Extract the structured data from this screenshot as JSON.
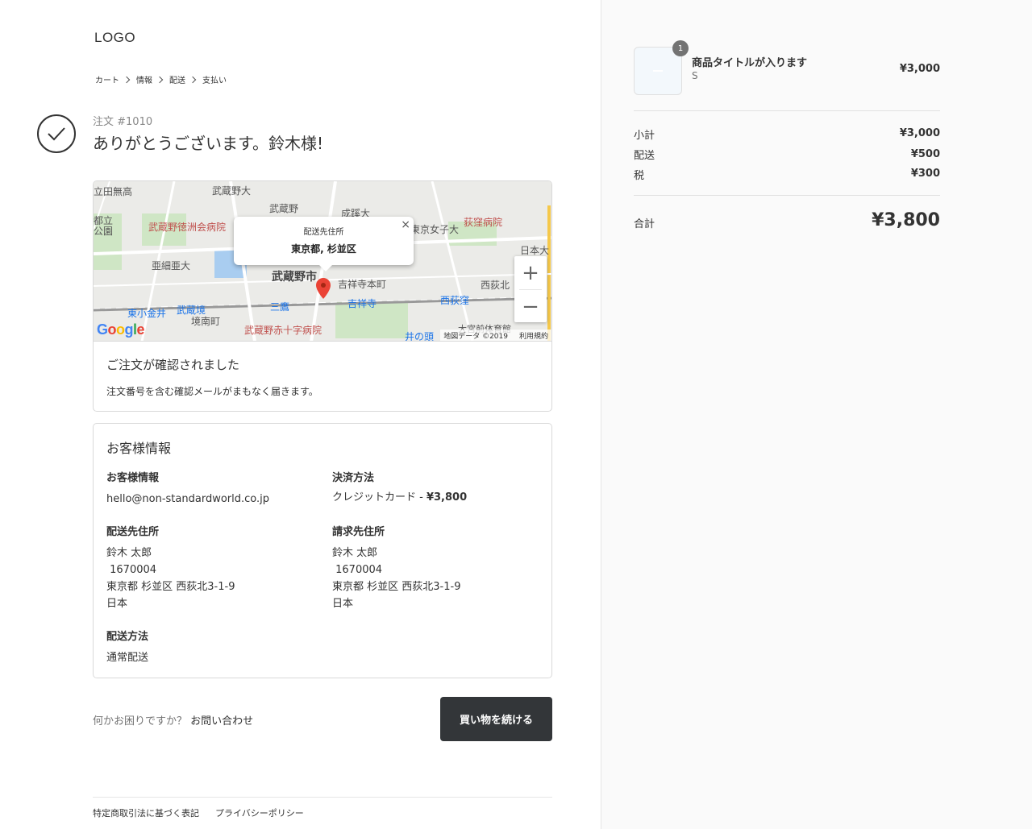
{
  "header": {
    "logo": "LOGO"
  },
  "breadcrumb": [
    "カート",
    "情報",
    "配送",
    "支払い"
  ],
  "order": {
    "number": "注文 #1010",
    "thanks": "ありがとうございます。鈴木様!"
  },
  "map": {
    "popup_title": "配送先住所",
    "popup_address": "東京都, 杉並区",
    "close": "×",
    "zoom_in": "+",
    "zoom_out": "−",
    "google": "Google",
    "attribution": "地図データ ©2019",
    "terms": "利用規約",
    "labels": {
      "l1": "立田無高",
      "l2": "武蔵野大",
      "l3": "武蔵野",
      "l4": "成蹊大",
      "l5": "武蔵野徳洲会病院",
      "l6": "荻窪病院",
      "l7": "東京女子大",
      "l8": "日本大",
      "l9": "亜細亜大",
      "l10": "武蔵野市",
      "l11": "吉祥寺本町",
      "l12": "西荻北",
      "l13": "東小金井",
      "l14": "武蔵境",
      "l15": "三鷹",
      "l16": "吉祥寺",
      "l17": "西荻窪",
      "l18": "境南町",
      "l19": "武蔵野赤十字病院",
      "l20": "井の頭",
      "l21": "都立",
      "l22": "公園",
      "l23": "大宮前体育館"
    }
  },
  "confirmation": {
    "title": "ご注文が確認されました",
    "text": "注文番号を含む確認メールがまもなく届きます。"
  },
  "customer": {
    "title": "お客様情報",
    "contact_label": "お客様情報",
    "contact_value": "hello@non-standardworld.co.jp",
    "payment_label": "決済方法",
    "payment_method": "クレジットカード - ",
    "payment_amount": "¥3,800",
    "shipping_address_label": "配送先住所",
    "shipping_address": [
      "鈴木 太郎",
      " 1670004",
      "東京都 杉並区 西荻北3-1-9",
      "日本"
    ],
    "billing_address_label": "請求先住所",
    "billing_address": [
      "鈴木 太郎",
      " 1670004",
      "東京都 杉並区 西荻北3-1-9",
      "日本"
    ],
    "shipping_method_label": "配送方法",
    "shipping_method": "通常配送"
  },
  "help": {
    "question": "何かお困りですか？",
    "contact_link": "お問い合わせ"
  },
  "continue_button": "買い物を続ける",
  "footer": {
    "links": [
      "特定商取引法に基づく表記",
      "プライバシーポリシー"
    ]
  },
  "cart": {
    "item": {
      "quantity": "1",
      "title": "商品タイトルが入ります",
      "variant": "S",
      "price": "¥3,000"
    },
    "subtotal_label": "小計",
    "subtotal": "¥3,000",
    "shipping_label": "配送",
    "shipping": "¥500",
    "tax_label": "税",
    "tax": "¥300",
    "total_label": "合計",
    "total": "¥3,800"
  }
}
